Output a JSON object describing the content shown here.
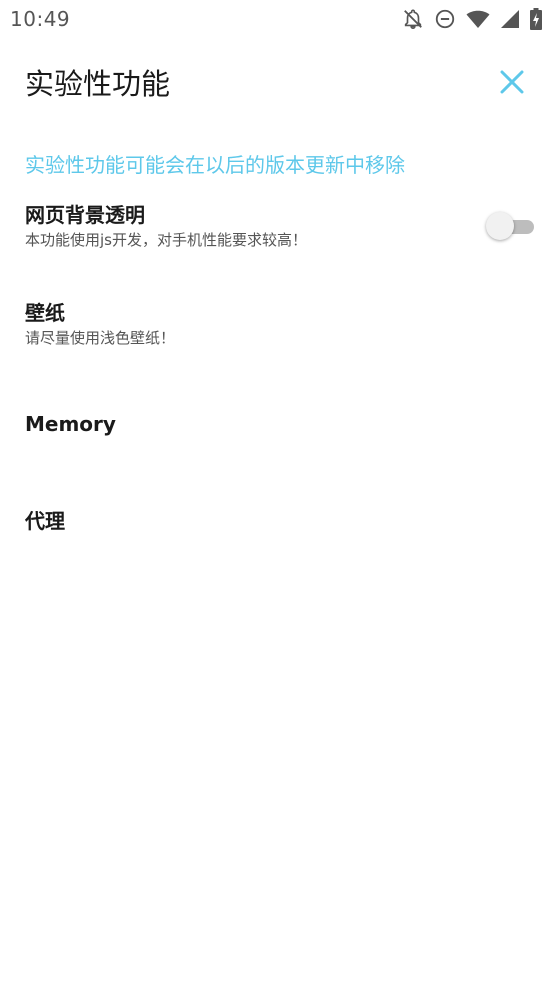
{
  "status_bar": {
    "time": "10:49",
    "icons": [
      "notifications-off-icon",
      "do-not-disturb-icon",
      "wifi-icon",
      "cell-signal-icon",
      "battery-charging-icon"
    ]
  },
  "header": {
    "title": "实验性功能",
    "close_icon": "close-icon",
    "accent_color": "#5ec8ea"
  },
  "notice": "实验性功能可能会在以后的版本更新中移除",
  "settings": [
    {
      "title": "网页背景透明",
      "subtitle": "本功能使用js开发，对手机性能要求较高！",
      "toggle": false
    },
    {
      "title": "壁纸",
      "subtitle": "请尽量使用浅色壁纸！"
    },
    {
      "title": "Memory"
    },
    {
      "title": "代理"
    }
  ]
}
